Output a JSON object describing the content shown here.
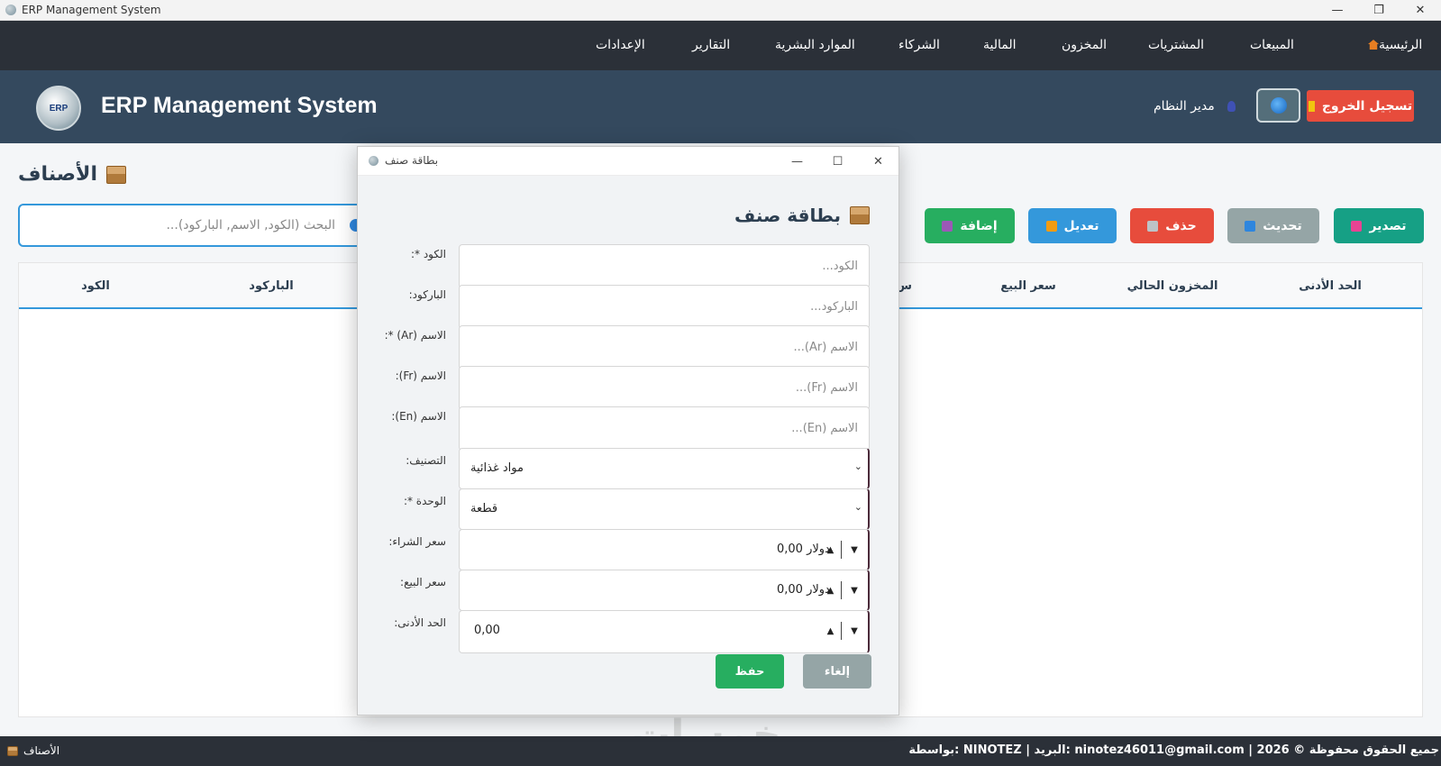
{
  "window": {
    "title": "ERP Management System"
  },
  "nav": {
    "home": "الرئيسية",
    "sales": "المبيعات",
    "purchases": "المشتريات",
    "inventory": "المخزون",
    "finance": "المالية",
    "partners": "الشركاء",
    "hr": "الموارد البشرية",
    "reports": "التقارير",
    "settings": "الإعدادات"
  },
  "header": {
    "logo_text": "ERP",
    "title": "ERP Management System",
    "user_name": "مدير النظام",
    "logout": "تسجيل الخروج"
  },
  "page": {
    "title": "الأصناف",
    "search_placeholder": "البحث (الكود, الاسم, الباركود)...",
    "actions": {
      "export": "تصدير",
      "refresh": "تحديث",
      "delete": "حذف",
      "edit": "تعديل",
      "add": "إضافة"
    },
    "columns": {
      "min": "الحد الأدنى",
      "stock": "المخزون الحالي",
      "sale_price": "سعر البيع",
      "partial": "س",
      "barcode": "الباركود",
      "code": "الكود"
    }
  },
  "dialog": {
    "window_title": "بطاقة صنف",
    "heading": "بطاقة صنف",
    "fields": {
      "code": {
        "label": "الكود *:",
        "placeholder": "الكود..."
      },
      "barcode": {
        "label": "الباركود:",
        "placeholder": "الباركود..."
      },
      "name_ar": {
        "label": "الاسم (Ar) *:",
        "placeholder": "الاسم (Ar)..."
      },
      "name_fr": {
        "label": "الاسم (Fr):",
        "placeholder": "الاسم (Fr)..."
      },
      "name_en": {
        "label": "الاسم (En):",
        "placeholder": "الاسم (En)..."
      },
      "category": {
        "label": "التصنيف:",
        "value": "مواد غذائية"
      },
      "unit": {
        "label": "الوحدة *:",
        "value": "قطعة"
      },
      "purchase_price": {
        "label": "سعر الشراء:",
        "value": "0,00 دولار"
      },
      "sale_price": {
        "label": "سعر البيع:",
        "value": "0,00 دولار"
      },
      "min_qty": {
        "label": "الحد الأدنى:",
        "value": "0,00"
      }
    },
    "save": "حفظ",
    "cancel": "إلغاء"
  },
  "footer": {
    "credits": "بواسطة: NINOTEZ | البريد: ninotez46011@gmail.com | جميع الحقوق محفوظة © 2026",
    "section": "الأصناف"
  },
  "watermark": "خمسات",
  "colors": {
    "nav_bg": "#2b3038",
    "header_bg": "#34495e",
    "export": "#16a085",
    "refresh": "#95a5a6",
    "delete": "#e74c3c",
    "edit": "#3498db",
    "add": "#27ae60",
    "save": "#27ae60",
    "cancel": "#95a5a6",
    "logout": "#e74c3c"
  }
}
